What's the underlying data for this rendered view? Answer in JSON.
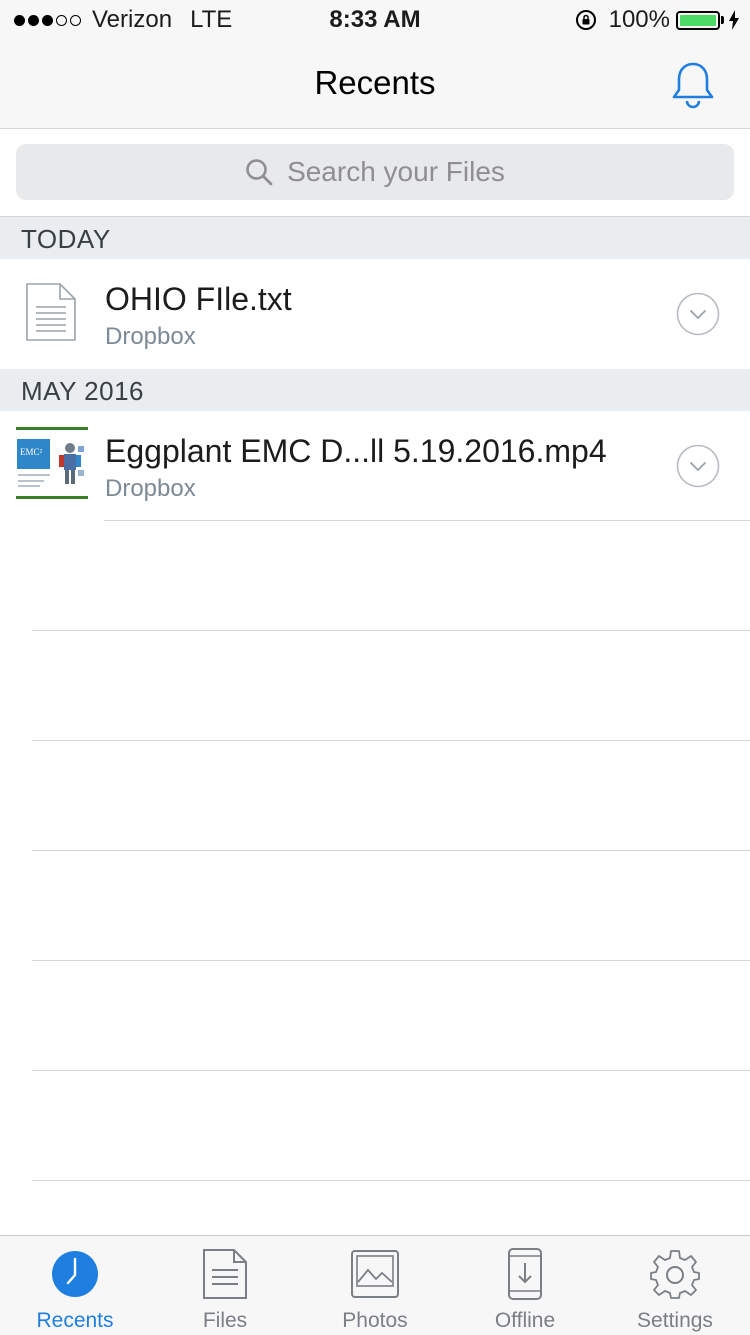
{
  "status_bar": {
    "carrier": "Verizon",
    "network": "LTE",
    "time": "8:33 AM",
    "battery_percent": "100%",
    "battery_level": 1.0,
    "signal_bars_filled": 3,
    "signal_bars_total": 5
  },
  "header": {
    "title": "Recents"
  },
  "search": {
    "placeholder": "Search your Files"
  },
  "sections": [
    {
      "title": "TODAY",
      "items": [
        {
          "name": "OHIO FIle.txt",
          "source": "Dropbox",
          "icon": "text-file-icon"
        }
      ]
    },
    {
      "title": "MAY 2016",
      "items": [
        {
          "name": "Eggplant EMC D...ll 5.19.2016.mp4",
          "source": "Dropbox",
          "icon": "video-thumbnail",
          "thumb_text": "EMC²"
        }
      ]
    }
  ],
  "tabs": [
    {
      "label": "Recents",
      "icon": "clock-icon",
      "active": true
    },
    {
      "label": "Files",
      "icon": "document-icon",
      "active": false
    },
    {
      "label": "Photos",
      "icon": "photo-icon",
      "active": false
    },
    {
      "label": "Offline",
      "icon": "offline-phone-icon",
      "active": false
    },
    {
      "label": "Settings",
      "icon": "gear-icon",
      "active": false
    }
  ],
  "colors": {
    "accent": "#1f7fe0",
    "battery": "#4cd964",
    "section_bg": "#e9edf0",
    "subtitle": "#7d8a96"
  }
}
